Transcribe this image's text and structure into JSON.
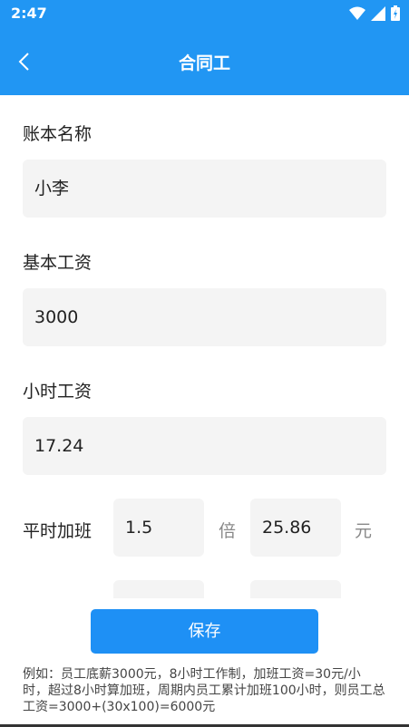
{
  "status_bar": {
    "time": "2:47"
  },
  "header": {
    "title": "合同工"
  },
  "form": {
    "account_name": {
      "label": "账本名称",
      "value": "小李"
    },
    "base_salary": {
      "label": "基本工资",
      "value": "3000"
    },
    "hourly_wage": {
      "label": "小时工资",
      "value": "17.24"
    },
    "overtime": {
      "label": "平时加班",
      "multiplier": "1.5",
      "multiplier_unit": "倍",
      "amount": "25.86",
      "amount_unit": "元"
    }
  },
  "save_button": "保存",
  "note": "例如：员工底薪3000元，8小时工作制，加班工资=30元/小时，超过8小时算加班，周期内员工累计加班100小时，则员工总工资=3000+(30x100)=6000元",
  "colors": {
    "primary": "#2196F3",
    "button": "#1E90F5",
    "field_bg": "#f4f4f4"
  },
  "icons": [
    "wifi-icon",
    "signal-icon",
    "battery-icon",
    "back-arrow-icon"
  ]
}
